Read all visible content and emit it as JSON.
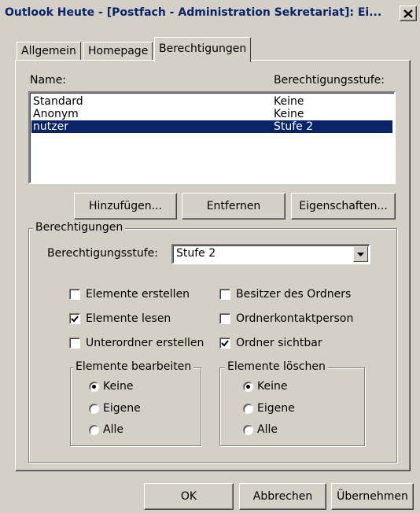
{
  "window": {
    "title": "Outlook Heute - [Postfach - Administration Sekretariat]: Ei...",
    "close_glyph": "X"
  },
  "tabs": [
    {
      "label": "Allgemein",
      "active": false
    },
    {
      "label": "Homepage",
      "active": false
    },
    {
      "label": "Berechtigungen",
      "active": true
    }
  ],
  "permissions_list": {
    "col_name": "Name:",
    "col_level": "Berechtigungsstufe:",
    "rows": [
      {
        "name": "Standard",
        "level": "Keine",
        "selected": false
      },
      {
        "name": "Anonym",
        "level": "Keine",
        "selected": false
      },
      {
        "name": "nutzer",
        "level": "Stufe 2",
        "selected": true
      }
    ]
  },
  "list_buttons": {
    "add": "Hinzufügen...",
    "remove": "Entfernen",
    "properties": "Eigenschaften..."
  },
  "permissions_group": {
    "title": "Berechtigungen",
    "level_label": "Berechtigungsstufe:",
    "level_value": "Stufe 2",
    "checkboxes": {
      "create_items": {
        "label": "Elemente erstellen",
        "checked": false
      },
      "read_items": {
        "label": "Elemente lesen",
        "checked": true
      },
      "create_subfolders": {
        "label": "Unterordner erstellen",
        "checked": false
      },
      "folder_owner": {
        "label": "Besitzer des Ordners",
        "checked": false
      },
      "folder_contact": {
        "label": "Ordnerkontaktperson",
        "checked": false
      },
      "folder_visible": {
        "label": "Ordner sichtbar",
        "checked": true
      }
    },
    "edit_items": {
      "title": "Elemente bearbeiten",
      "options": [
        "Keine",
        "Eigene",
        "Alle"
      ],
      "selected": "Keine"
    },
    "delete_items": {
      "title": "Elemente löschen",
      "options": [
        "Keine",
        "Eigene",
        "Alle"
      ],
      "selected": "Keine"
    }
  },
  "dialog_buttons": {
    "ok": "OK",
    "cancel": "Abbrechen",
    "apply": "Übernehmen"
  },
  "colors": {
    "face": "#d4d0c8",
    "selection": "#0a246a",
    "title_text": "#0a246a"
  }
}
